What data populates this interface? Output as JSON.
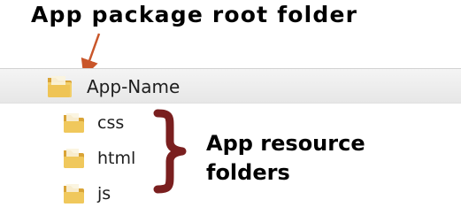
{
  "annotations": {
    "top_callout": "App package root folder",
    "resource_callout_line1": "App resource",
    "resource_callout_line2": "folders"
  },
  "tree": {
    "root": {
      "label": "App-Name",
      "icon": "folder-icon",
      "selected": true
    },
    "children": [
      {
        "label": "css",
        "icon": "folder-icon"
      },
      {
        "label": "html",
        "icon": "folder-icon"
      },
      {
        "label": "js",
        "icon": "folder-icon"
      }
    ]
  },
  "colors": {
    "arrow": "#c9562a",
    "brace": "#7a1f1f",
    "folder_front": "#f2cf6a",
    "folder_back": "#d9a437",
    "row_highlight": "#ececec"
  }
}
